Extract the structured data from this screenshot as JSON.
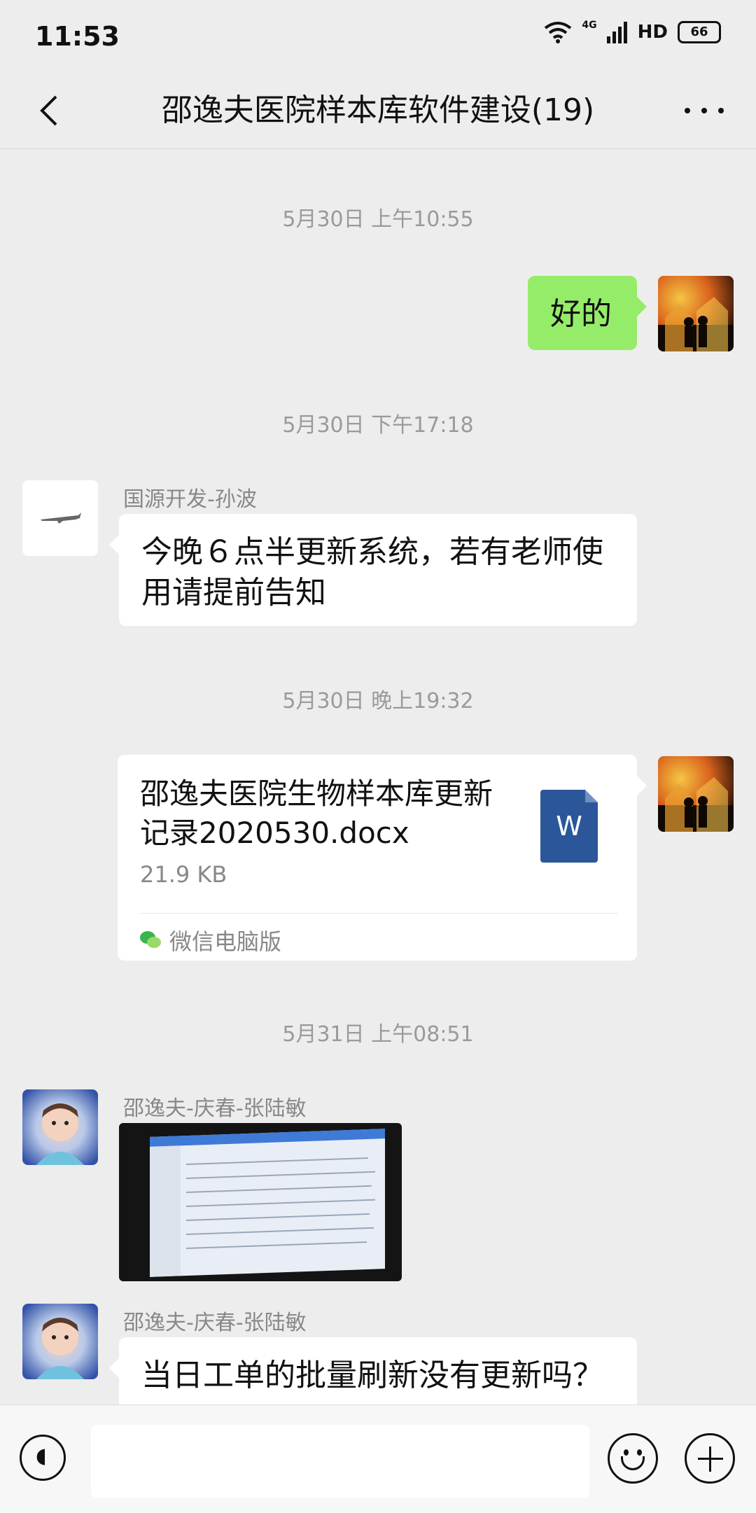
{
  "status_bar": {
    "time": "11:53",
    "network": "4G",
    "hd": "HD",
    "battery": "66"
  },
  "header": {
    "title": "邵逸夫医院样本库软件建设(19)"
  },
  "messages": [
    {
      "type": "timestamp",
      "text": "5月30日 上午10:55"
    },
    {
      "type": "text",
      "side": "right",
      "text": "好的"
    },
    {
      "type": "timestamp",
      "text": "5月30日 下午17:18"
    },
    {
      "type": "text",
      "side": "left",
      "sender": "国源开发-孙波",
      "text": "今晚６点半更新系统，若有老师使用请提前告知"
    },
    {
      "type": "timestamp",
      "text": "5月30日 晚上19:32"
    },
    {
      "type": "file",
      "side": "right",
      "file_name": "邵逸夫医院生物样本库更新记录2020530.docx",
      "file_size": "21.9 KB",
      "file_icon_label": "W",
      "source": "微信电脑版"
    },
    {
      "type": "timestamp",
      "text": "5月31日 上午08:51"
    },
    {
      "type": "image",
      "side": "left",
      "sender": "邵逸夫-庆春-张陆敏"
    },
    {
      "type": "text",
      "side": "left",
      "sender": "邵逸夫-庆春-张陆敏",
      "text": "当日工单的批量刷新没有更新吗？"
    }
  ],
  "input_bar": {
    "placeholder": ""
  },
  "colors": {
    "background": "#ededed",
    "self_bubble": "#95ec69",
    "other_bubble": "#ffffff",
    "word_icon": "#2b579a"
  }
}
